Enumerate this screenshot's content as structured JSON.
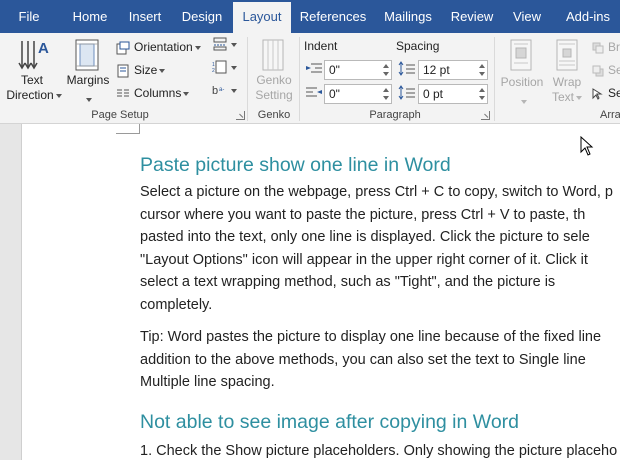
{
  "tabs": [
    {
      "label": "File",
      "active": false
    },
    {
      "label": "Home",
      "active": false
    },
    {
      "label": "Insert",
      "active": false
    },
    {
      "label": "Design",
      "active": false
    },
    {
      "label": "Layout",
      "active": true
    },
    {
      "label": "References",
      "active": false
    },
    {
      "label": "Mailings",
      "active": false
    },
    {
      "label": "Review",
      "active": false
    },
    {
      "label": "View",
      "active": false
    },
    {
      "label": "Add-ins",
      "active": false
    }
  ],
  "ribbon": {
    "page_setup": {
      "text_direction_line1": "Text",
      "text_direction_line2": "Direction",
      "margins": "Margins",
      "orientation": "Orientation",
      "size": "Size",
      "columns": "Columns",
      "group_label": "Page Setup"
    },
    "genko": {
      "line1": "Genko",
      "line2": "Setting",
      "group_label": "Genko"
    },
    "paragraph": {
      "indent_label": "Indent",
      "spacing_label": "Spacing",
      "indent_left": "0\"",
      "indent_right": "0\"",
      "spacing_before": "12 pt",
      "spacing_after": "0 pt",
      "group_label": "Paragraph"
    },
    "arrange": {
      "position": "Position",
      "wrap_line1": "Wrap",
      "wrap_line2": "Text",
      "br_partial": "Br",
      "se_partial1": "Se",
      "se_partial2": "Se",
      "group_label_partial": "Arra"
    }
  },
  "document": {
    "heading1": "Paste picture show one line in Word",
    "para1_lines": [
      "Select a picture on the webpage, press Ctrl + C to copy, switch to Word, p",
      "cursor where you want to paste the picture, press Ctrl + V to paste, th",
      "pasted into the text, only one line is displayed. Click the picture to sele",
      "\"Layout Options\" icon will appear in the upper right corner of it. Click it",
      "select a text wrapping method, such as \"Tight\", and the picture is",
      "completely."
    ],
    "para2_lines": [
      "Tip: Word pastes the picture to display one line because of the fixed line",
      "addition to the above methods, you can also set the text to Single line",
      "Multiple line spacing."
    ],
    "heading2": "Not able to see image after copying in Word",
    "para3_line": "1. Check the Show picture placeholders. Only showing the picture placeho"
  },
  "colors": {
    "tab_bar": "#2b579a",
    "ribbon_bg": "#f3f3f3",
    "heading": "#2e8fa0",
    "doc_bg": "#e6e6e6"
  }
}
